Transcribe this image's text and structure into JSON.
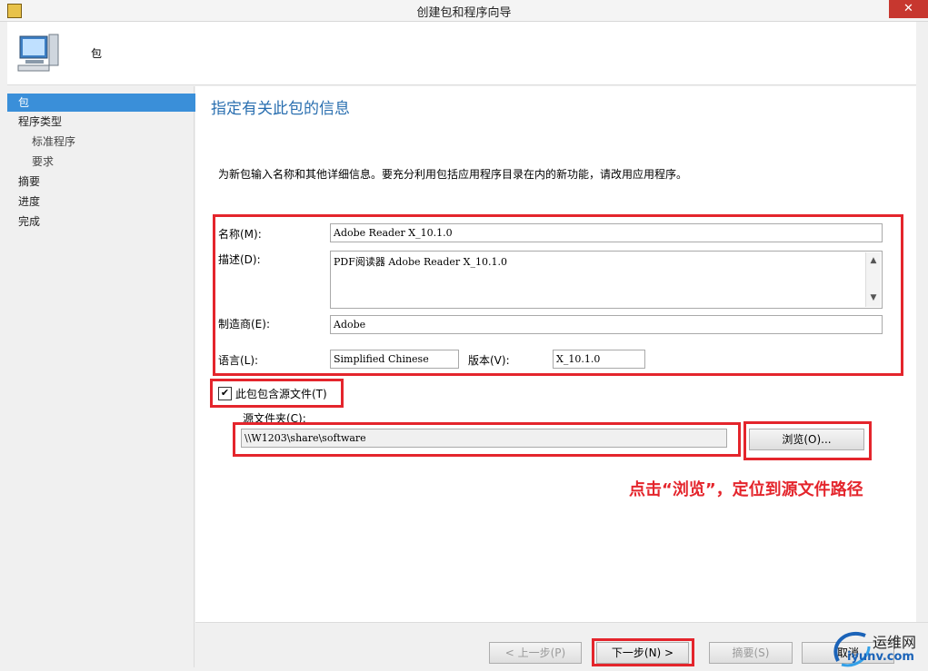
{
  "window": {
    "title": "创建包和程序向导",
    "close_label": "✕"
  },
  "header": {
    "title": "包",
    "icon": "computer-icon"
  },
  "sidebar": {
    "items": [
      {
        "label": "包",
        "active": true
      },
      {
        "label": "程序类型"
      },
      {
        "label": "标准程序"
      },
      {
        "label": "要求"
      },
      {
        "label": "摘要"
      },
      {
        "label": "进度"
      },
      {
        "label": "完成"
      }
    ]
  },
  "main": {
    "heading": "指定有关此包的信息",
    "intro": "为新包输入名称和其他详细信息。要充分利用包括应用程序目录在内的新功能，请改用应用程序。",
    "name": {
      "label": "名称(M):",
      "value": "Adobe Reader X_10.1.0"
    },
    "description": {
      "label": "描述(D):",
      "value": "PDF阅读器 Adobe Reader X_10.1.0"
    },
    "manufacturer": {
      "label": "制造商(E):",
      "value": "Adobe"
    },
    "language": {
      "label": "语言(L):",
      "value": "Simplified Chinese"
    },
    "version": {
      "label": "版本(V):",
      "value": "X_10.1.0"
    },
    "source_checkbox": {
      "label": "此包包含源文件(T)",
      "checked": true
    },
    "source_folder": {
      "label": "源文件夹(C):",
      "value": "\\\\W1203\\share\\software"
    },
    "browse_label": "浏览(O)...",
    "annotation": "点击“浏览”，定位到源文件路径"
  },
  "footer": {
    "prev_label": "< 上一步(P)",
    "next_label": "下一步(N) >",
    "summary_label": "摘要(S)",
    "cancel_label": "取消"
  },
  "watermark": {
    "text": "运维网",
    "url": "iyunv.com"
  },
  "colors": {
    "highlight": "#e4252c",
    "accent": "#3a8fd9",
    "heading": "#2a6fb0"
  }
}
